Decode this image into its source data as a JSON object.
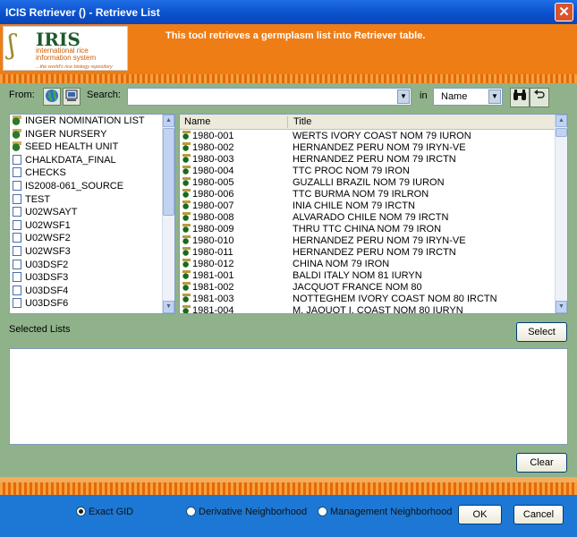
{
  "window": {
    "title": "ICIS Retriever () - Retrieve List",
    "close_glyph": "✕"
  },
  "logo": {
    "mark": "IRIS",
    "line1": "international rice",
    "line2": "information system",
    "tagline": "...the world's rice biology repository"
  },
  "banner_text": "This tool retrieves a germplasm list into Retriever table.",
  "from_label": "From:",
  "search": {
    "label": "Search:",
    "value": "",
    "in_label": "in",
    "field_value": "Name"
  },
  "source_lists": [
    {
      "label": "INGER NOMINATION LIST",
      "icon": "db"
    },
    {
      "label": "INGER NURSERY",
      "icon": "db"
    },
    {
      "label": "SEED HEALTH UNIT",
      "icon": "db"
    },
    {
      "label": "CHALKDATA_FINAL",
      "icon": "doc"
    },
    {
      "label": "CHECKS",
      "icon": "doc"
    },
    {
      "label": "IS2008-061_SOURCE",
      "icon": "doc"
    },
    {
      "label": "TEST",
      "icon": "doc"
    },
    {
      "label": "U02WSAYT",
      "icon": "doc"
    },
    {
      "label": "U02WSF1",
      "icon": "doc"
    },
    {
      "label": "U02WSF2",
      "icon": "doc"
    },
    {
      "label": "U02WSF3",
      "icon": "doc"
    },
    {
      "label": "U03DSF2",
      "icon": "doc"
    },
    {
      "label": "U03DSF3",
      "icon": "doc"
    },
    {
      "label": "U03DSF4",
      "icon": "doc"
    },
    {
      "label": "U03DSF6",
      "icon": "doc"
    }
  ],
  "grid": {
    "columns": [
      "Name",
      "Title"
    ],
    "rows": [
      [
        "1980-001",
        "WERTS IVORY COAST NOM 79 IURON"
      ],
      [
        "1980-002",
        "HERNANDEZ PERU NOM 79 IRYN-VE"
      ],
      [
        "1980-003",
        "HERNANDEZ PERU NOM 79 IRCTN"
      ],
      [
        "1980-004",
        "TTC PROC NOM 79 IRON"
      ],
      [
        "1980-005",
        "GUZALLI BRAZIL NOM 79 IURON"
      ],
      [
        "1980-006",
        "TTC BURMA NOM 79 IRLRON"
      ],
      [
        "1980-007",
        "INIA CHILE NOM 79 IRCTN"
      ],
      [
        "1980-008",
        "ALVARADO CHILE NOM 79 IRCTN"
      ],
      [
        "1980-009",
        "THRU TTC CHINA NOM 79 IRON"
      ],
      [
        "1980-010",
        "HERNANDEZ PERU NOM 79 IRYN-VE"
      ],
      [
        "1980-011",
        "HERNANDEZ PERU NOM 79 IRCTN"
      ],
      [
        "1980-012",
        "CHINA NOM 79 IRON"
      ],
      [
        "1981-001",
        "BALDI ITALY NOM 81 IURYN"
      ],
      [
        "1981-002",
        "JACQUOT FRANCE NOM 80"
      ],
      [
        "1981-003",
        "NOTTEGHEM IVORY COAST NOM 80 IRCTN"
      ],
      [
        "1981-004",
        "M. JAQUOT I. COAST NOM 80 IURYN"
      ]
    ]
  },
  "selected_lists_label": "Selected Lists",
  "buttons": {
    "select": "Select",
    "clear": "Clear",
    "ok": "OK",
    "cancel": "Cancel"
  },
  "options": [
    {
      "label": "Exact GID",
      "selected": true
    },
    {
      "label": "Derivative Neighborhood",
      "selected": false
    },
    {
      "label": "Management Neighborhood",
      "selected": false
    }
  ]
}
